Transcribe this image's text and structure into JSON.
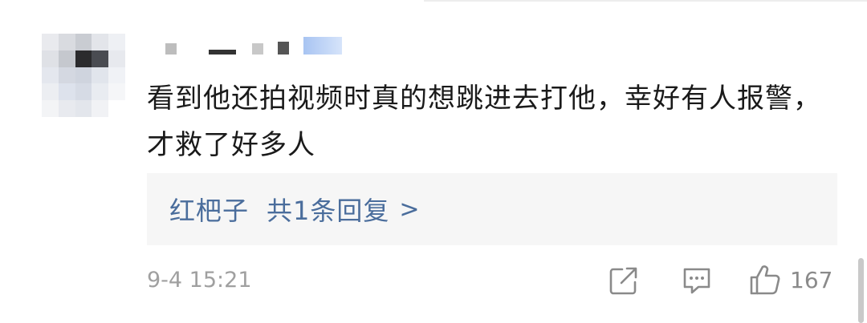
{
  "comment": {
    "text": "看到他还拍视频时真的想跳进去打他，幸好有人报警，才救了好多人",
    "reply_preview": {
      "author": "红杷子",
      "label": "共1条回复",
      "chevron": ">"
    },
    "timestamp": "9-4 15:21",
    "likes": "167"
  },
  "icons": {
    "share": "share-icon",
    "comment": "comment-icon",
    "like": "thumbs-up-icon"
  },
  "colors": {
    "text": "#1a1a1a",
    "link": "#4a6d9c",
    "muted": "#a0a0a0",
    "reply_bg": "#f6f6f6"
  }
}
